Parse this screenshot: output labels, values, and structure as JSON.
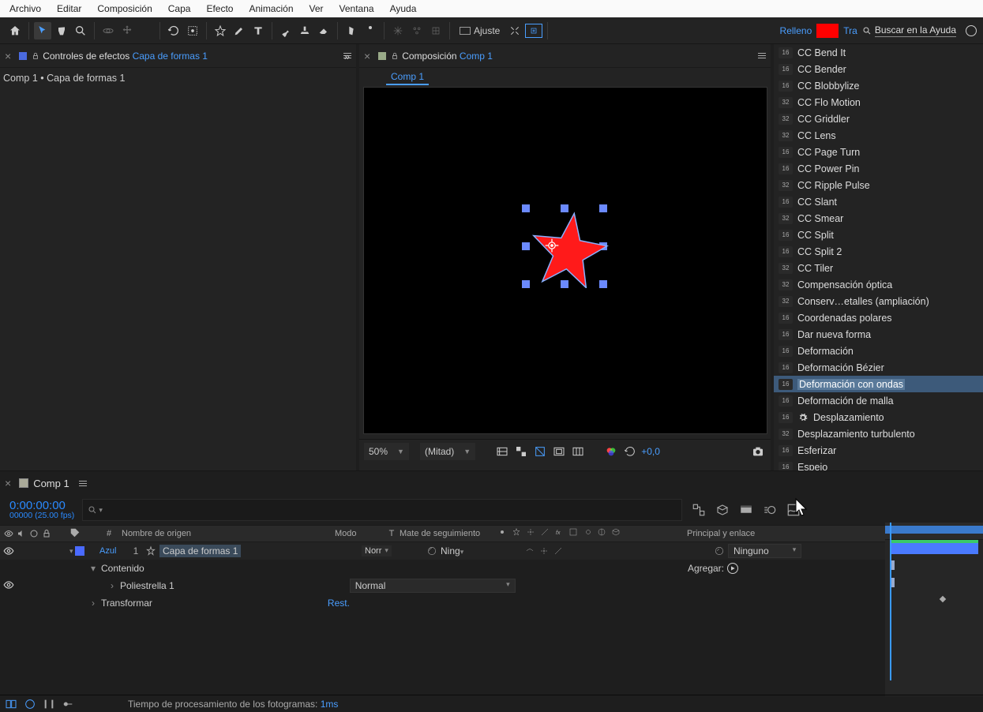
{
  "menubar": [
    "Archivo",
    "Editar",
    "Composición",
    "Capa",
    "Efecto",
    "Animación",
    "Ver",
    "Ventana",
    "Ayuda"
  ],
  "toolbar": {
    "adjust_label": "Ajuste",
    "fill_label": "Relleno",
    "stroke_prefix": "Tra",
    "search_help": "Buscar en la Ayuda"
  },
  "effects_panel": {
    "title": "Controles de efectos",
    "layer": "Capa de formas 1",
    "breadcrumb": "Comp 1 • Capa de formas 1"
  },
  "comp_panel": {
    "title": "Composición",
    "comp": "Comp 1",
    "tab": "Comp 1"
  },
  "viewer": {
    "zoom": "50%",
    "res": "(Mitad)",
    "exposure": "+0,0"
  },
  "effects_list": [
    {
      "bit": "16",
      "name": "CC Bend It",
      "gear": false
    },
    {
      "bit": "16",
      "name": "CC Bender",
      "gear": false
    },
    {
      "bit": "16",
      "name": "CC Blobbylize",
      "gear": false
    },
    {
      "bit": "32",
      "name": "CC Flo Motion",
      "gear": false
    },
    {
      "bit": "32",
      "name": "CC Griddler",
      "gear": false
    },
    {
      "bit": "32",
      "name": "CC Lens",
      "gear": false
    },
    {
      "bit": "16",
      "name": "CC Page Turn",
      "gear": false
    },
    {
      "bit": "16",
      "name": "CC Power Pin",
      "gear": false
    },
    {
      "bit": "32",
      "name": "CC Ripple Pulse",
      "gear": false
    },
    {
      "bit": "16",
      "name": "CC Slant",
      "gear": false
    },
    {
      "bit": "32",
      "name": "CC Smear",
      "gear": false
    },
    {
      "bit": "16",
      "name": "CC Split",
      "gear": false
    },
    {
      "bit": "16",
      "name": "CC Split 2",
      "gear": false
    },
    {
      "bit": "32",
      "name": "CC Tiler",
      "gear": false
    },
    {
      "bit": "32",
      "name": "Compensación óptica",
      "gear": false
    },
    {
      "bit": "32",
      "name": "Conserv…etalles (ampliación)",
      "gear": false
    },
    {
      "bit": "16",
      "name": "Coordenadas polares",
      "gear": false
    },
    {
      "bit": "16",
      "name": "Dar nueva forma",
      "gear": false
    },
    {
      "bit": "16",
      "name": "Deformación",
      "gear": false
    },
    {
      "bit": "16",
      "name": "Deformación Bézier",
      "gear": false
    },
    {
      "bit": "16",
      "name": "Deformación con ondas",
      "gear": false,
      "selected": true
    },
    {
      "bit": "16",
      "name": "Deformación de malla",
      "gear": false
    },
    {
      "bit": "16",
      "name": "Desplazamiento",
      "gear": true
    },
    {
      "bit": "32",
      "name": "Desplazamiento turbulento",
      "gear": false
    },
    {
      "bit": "16",
      "name": "Esferizar",
      "gear": false
    },
    {
      "bit": "16",
      "name": "Espejo",
      "gear": false
    }
  ],
  "timeline": {
    "comp": "Comp 1",
    "timecode": "0:00:00:00",
    "frame": "00000 (25.00 fps)",
    "columns": {
      "num": "#",
      "name": "Nombre de origen",
      "mode": "Modo",
      "t": "T",
      "track": "Mate de seguimiento",
      "parent": "Principal y enlace"
    },
    "layer": {
      "label": "Azul",
      "num": "1",
      "name": "Capa de formas 1",
      "mode": "Norr",
      "track": "Ning",
      "parent": "Ninguno"
    },
    "content": "Contenido",
    "add": "Agregar:",
    "polystar": "Poliestrella 1",
    "blend": "Normal",
    "transform": "Transformar",
    "reset": "Rest."
  },
  "footer": {
    "label": "Tiempo de procesamiento de los fotogramas:",
    "value": "1ms"
  }
}
